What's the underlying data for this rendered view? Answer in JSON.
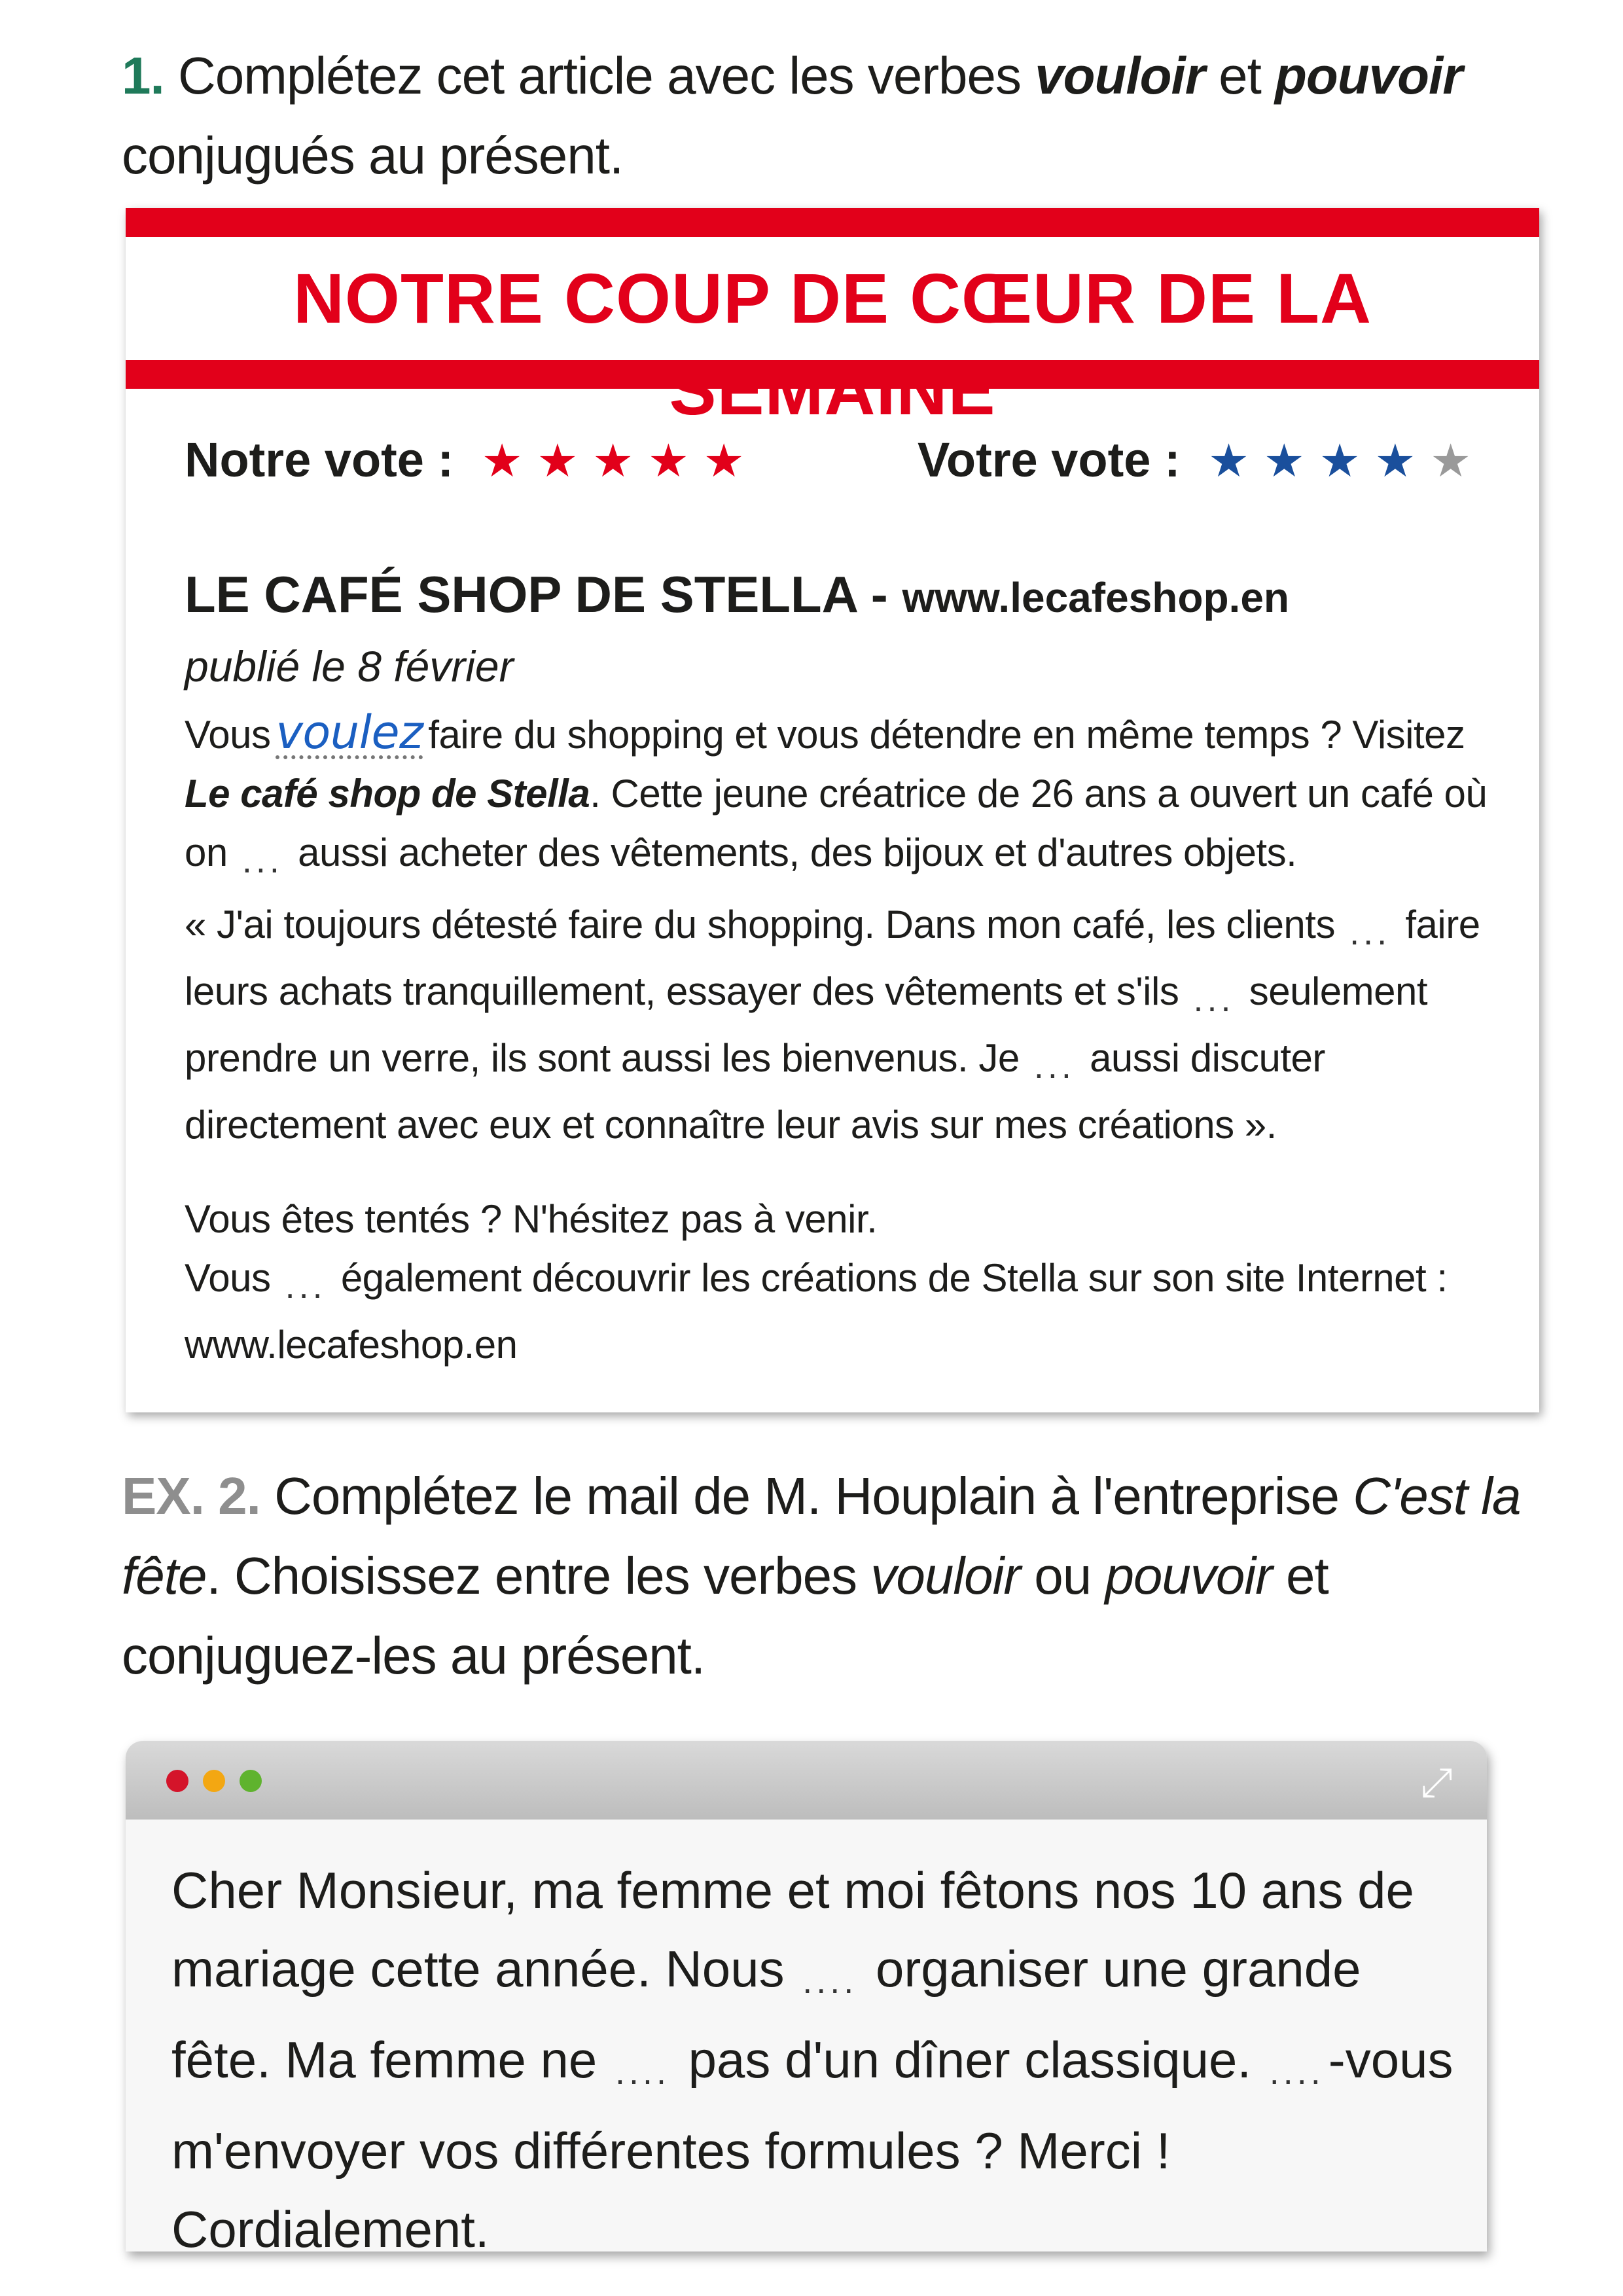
{
  "ex1": {
    "number": "1.",
    "text_a": "Complétez cet article avec les verbes ",
    "verb1": "vouloir",
    "text_b": " et ",
    "verb2": "pouvoir",
    "text_c": " conjugués au présent."
  },
  "article": {
    "banner": "NOTRE COUP DE CŒUR DE LA SEMAINE",
    "notre_vote_label": "Notre vote :",
    "votre_vote_label": "Votre vote :",
    "notre_vote_stars": 5,
    "votre_vote_stars": 4,
    "stars_total": 5,
    "star_glyph": "★",
    "shop_name": "LE CAFÉ SHOP DE STELLA",
    "separator": " - ",
    "shop_url": "www.lecafeshop.en",
    "published": "publié le 8 février",
    "p1_a": "Vous",
    "p1_answer": "voulez",
    "p1_b": "faire du shopping et vous détendre en même temps ? Visitez",
    "p1_italic": "Le café shop de Stella",
    "p1_c": ". Cette jeune créatrice de 26 ans a ouvert un café où on",
    "blank": "...",
    "p1_d": "aussi acheter des vêtements, des bijoux et d'autres objets.",
    "p2_a": "« J'ai toujours détesté faire du shopping. Dans mon café, les clients",
    "p2_b": "faire leurs achats tranquillement, essayer des vêtements et s'ils",
    "p2_c": "seulement prendre un verre, ils sont aussi les bienvenus. Je",
    "p2_d": "aussi discuter directement avec eux et connaître leur avis sur mes créations ».",
    "p3_a": "Vous êtes tentés ? N'hésitez pas à venir.",
    "p3_b": "Vous",
    "p3_c": "également découvrir les créations de Stella sur son site Internet :",
    "p3_url": "www.lecafeshop.en"
  },
  "ex2": {
    "number": "EX. 2.",
    "text_a": "Complétez le mail de M. Houplain à l'entreprise ",
    "company": "C'est la fête",
    "text_b": ". Choisissez entre les verbes ",
    "verb1": "vouloir",
    "text_c": " ou ",
    "verb2": "pouvoir",
    "text_d": " et conjuguez-les au présent."
  },
  "mail": {
    "line_a": "Cher Monsieur, ma femme et moi fêtons nos 10 ans de mariage cette année. Nous",
    "blank": "....",
    "line_b": "organiser une grande fête. Ma femme ne",
    "line_c": "pas d'un dîner classique.",
    "line_d": "-vous m'envoyer vos différentes formules ? Merci ! Cordialement.",
    "expand_icon": "⤢"
  },
  "colors": {
    "red": "#e2001a",
    "green_number": "#1f7a5a",
    "grey_number": "#8e8e8e",
    "blue_star": "#1a4f9c",
    "handwriting": "#1b5fc1"
  }
}
